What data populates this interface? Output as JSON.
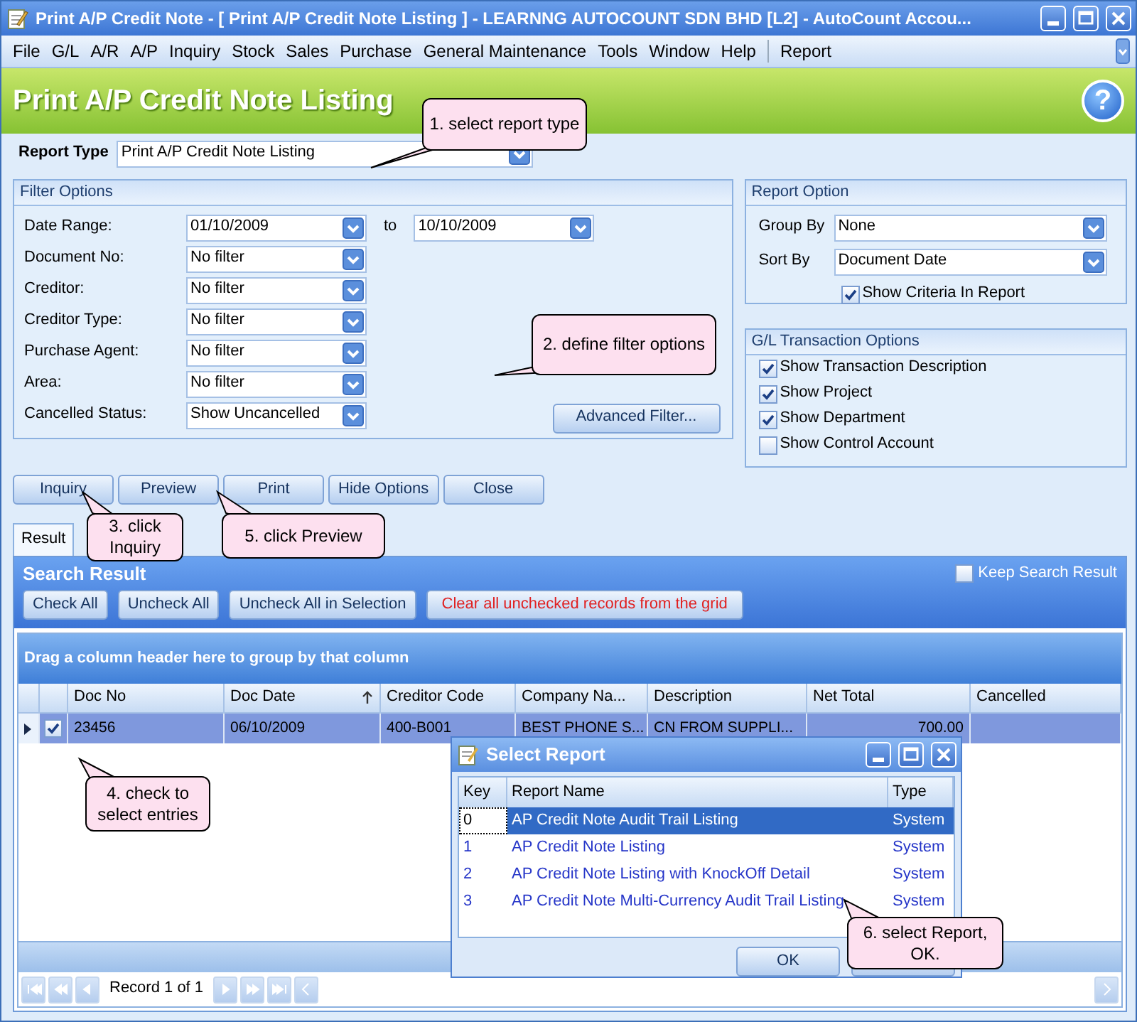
{
  "window": {
    "title": "Print A/P Credit Note - [ Print A/P Credit Note Listing ] - LEARNNG AUTOCOUNT SDN BHD [L2] - AutoCount Accou..."
  },
  "menu": [
    "File",
    "G/L",
    "A/R",
    "A/P",
    "Inquiry",
    "Stock",
    "Sales",
    "Purchase",
    "General Maintenance",
    "Tools",
    "Window",
    "Help",
    "Report"
  ],
  "header": {
    "title": "Print A/P Credit Note Listing",
    "help": "?"
  },
  "report_type": {
    "label": "Report Type",
    "value": "Print A/P Credit Note Listing"
  },
  "filter_options": {
    "title": "Filter Options",
    "fields": [
      {
        "label": "Date Range:",
        "value": "01/10/2009",
        "to_label": "to",
        "to_value": "10/10/2009"
      },
      {
        "label": "Document No:",
        "value": "No filter"
      },
      {
        "label": "Creditor:",
        "value": "No filter"
      },
      {
        "label": "Creditor Type:",
        "value": "No filter"
      },
      {
        "label": "Purchase Agent:",
        "value": "No filter"
      },
      {
        "label": "Area:",
        "value": "No filter"
      },
      {
        "label": "Cancelled Status:",
        "value": "Show Uncancelled"
      }
    ],
    "advanced_button": "Advanced Filter..."
  },
  "report_option": {
    "title": "Report Option",
    "fields": [
      {
        "label": "Group By",
        "value": "None"
      },
      {
        "label": "Sort By",
        "value": "Document Date"
      }
    ],
    "show_criteria": {
      "label": "Show Criteria In Report",
      "checked": true
    }
  },
  "gl_options": {
    "title": "G/L Transaction Options",
    "items": [
      {
        "label": "Show Transaction Description",
        "checked": true
      },
      {
        "label": "Show Project",
        "checked": true
      },
      {
        "label": "Show Department",
        "checked": true
      },
      {
        "label": "Show Control Account",
        "checked": false
      }
    ]
  },
  "buttons": [
    "Inquiry",
    "Preview",
    "Print",
    "Hide Options",
    "Close"
  ],
  "tabs": [
    {
      "label": "Result",
      "selected": true
    }
  ],
  "search_result": {
    "title": "Search Result",
    "keep": {
      "label": "Keep Search Result",
      "checked": false
    },
    "buttons": [
      {
        "label": "Check All",
        "kind": "normal"
      },
      {
        "label": "Uncheck All",
        "kind": "normal"
      },
      {
        "label": "Uncheck All in Selection",
        "kind": "normal"
      },
      {
        "label": "Clear all unchecked records from the grid",
        "kind": "warning"
      }
    ]
  },
  "grid": {
    "group_hint": "Drag a column header here to group by that column",
    "columns": [
      {
        "label": "Doc No",
        "sorted": false
      },
      {
        "label": "Doc Date",
        "sorted": true
      },
      {
        "label": "Creditor Code",
        "sorted": false
      },
      {
        "label": "Company Na...",
        "sorted": false
      },
      {
        "label": "Description",
        "sorted": false
      },
      {
        "label": "Net Total",
        "sorted": false
      },
      {
        "label": "Cancelled",
        "sorted": false
      }
    ],
    "rows": [
      {
        "current": true,
        "checked": true,
        "cells": [
          "23456",
          "06/10/2009",
          "400-B001",
          "BEST PHONE S...",
          "CN FROM SUPPLI...",
          "700.00",
          null
        ]
      }
    ]
  },
  "navigator": {
    "text": "Record 1 of 1"
  },
  "dialog": {
    "title": "Select Report",
    "columns": [
      "Key",
      "Report Name",
      "Type"
    ],
    "rows": [
      {
        "key": "0",
        "name": "AP Credit Note Audit Trail Listing",
        "type": "System",
        "selected": true
      },
      {
        "key": "1",
        "name": "AP Credit Note Listing",
        "type": "System",
        "selected": false
      },
      {
        "key": "2",
        "name": "AP Credit Note Listing with KnockOff Detail",
        "type": "System",
        "selected": false
      },
      {
        "key": "3",
        "name": "AP Credit Note Multi-Currency Audit Trail Listing",
        "type": "System",
        "selected": false
      }
    ],
    "ok_button": "OK"
  },
  "callouts": [
    {
      "text": "1. select report type"
    },
    {
      "text": "2. define filter options"
    },
    {
      "text": "3. click Inquiry"
    },
    {
      "text": "5. click Preview"
    },
    {
      "text": "4. check to select entries"
    },
    {
      "text": "6. select Report, OK."
    }
  ]
}
